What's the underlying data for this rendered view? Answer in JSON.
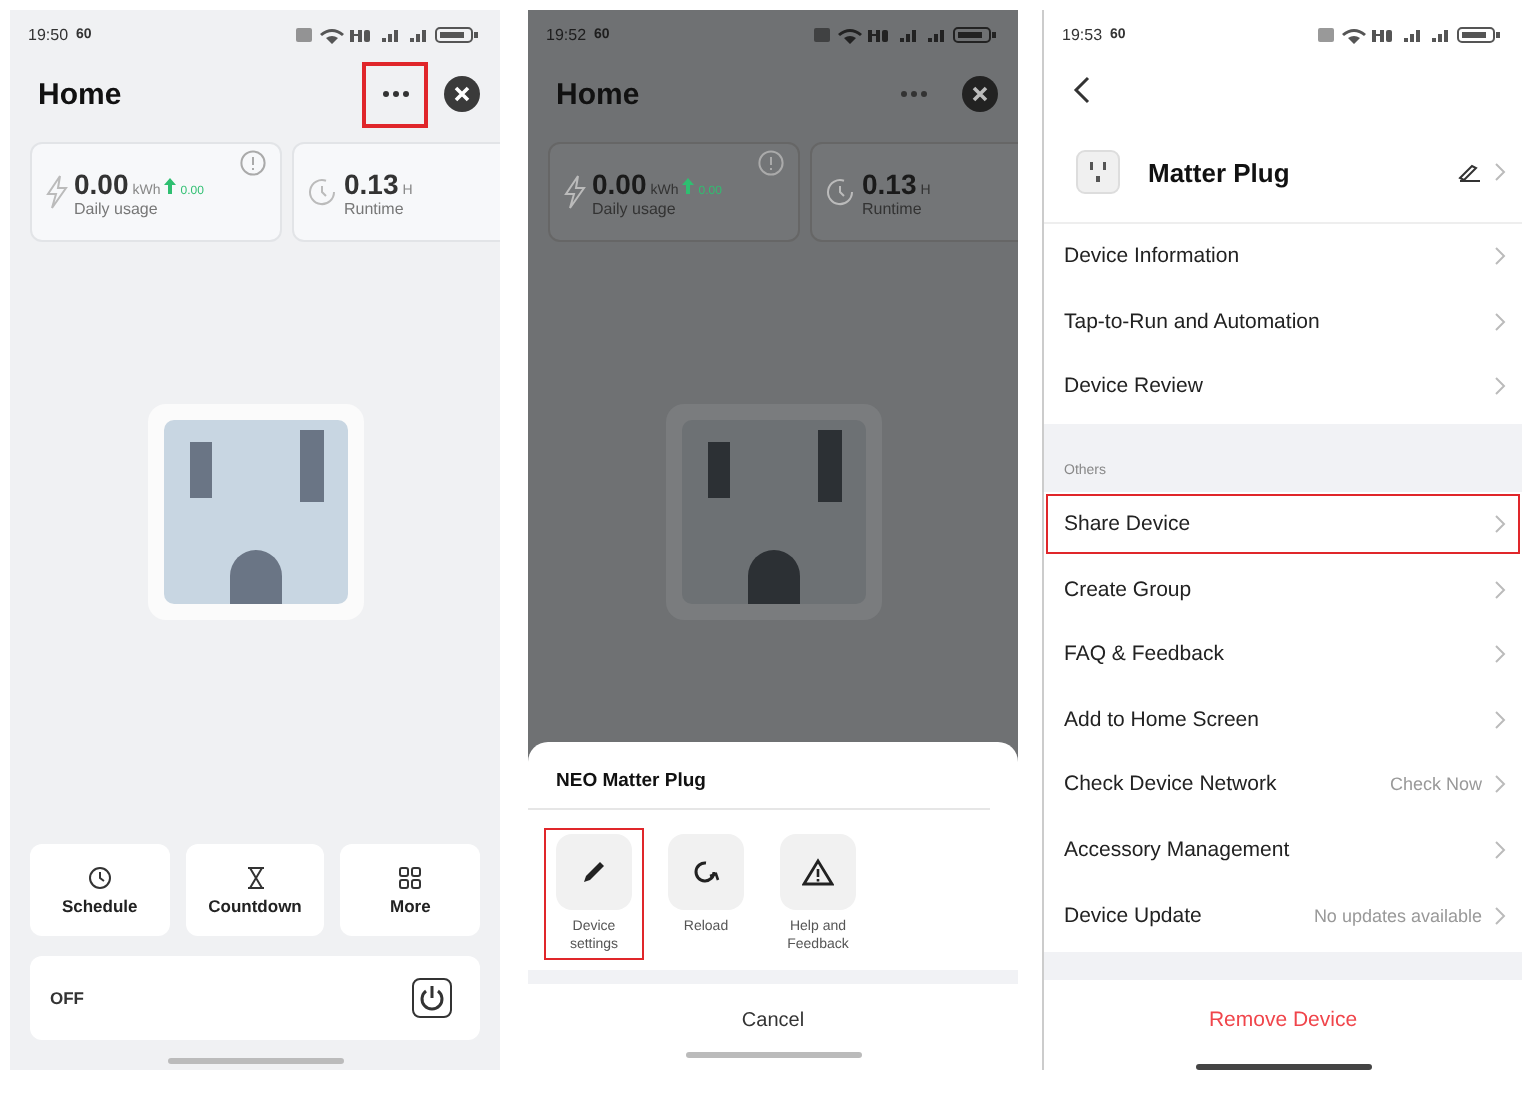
{
  "home_screen": {
    "status": {
      "time": "19:50",
      "speed": "60"
    },
    "title": "Home",
    "menu_highlighted": true,
    "stats": [
      {
        "value": "0.00",
        "unit": "kWh",
        "delta": "0.00",
        "label": "Daily usage"
      },
      {
        "value": "0.13",
        "unit": "H",
        "label": "Runtime"
      }
    ],
    "actions": [
      {
        "label": "Schedule"
      },
      {
        "label": "Countdown"
      },
      {
        "label": "More"
      }
    ],
    "power": {
      "label": "OFF",
      "on": false
    }
  },
  "menu_screen": {
    "status": {
      "time": "19:52",
      "speed": "60"
    },
    "title": "Home",
    "stats": [
      {
        "value": "0.00",
        "unit": "kWh",
        "delta": "0.00",
        "label": "Daily usage"
      },
      {
        "value": "0.13",
        "unit": "H",
        "label": "Runtime"
      }
    ],
    "sheet": {
      "title": "NEO Matter Plug",
      "actions": [
        {
          "label": "Device settings",
          "highlighted": true
        },
        {
          "label": "Reload",
          "highlighted": false
        },
        {
          "label": "Help and Feedback",
          "highlighted": false
        }
      ],
      "cancel": "Cancel"
    }
  },
  "settings_screen": {
    "status": {
      "time": "19:53",
      "speed": "60"
    },
    "device_name": "Matter Plug",
    "groups": [
      {
        "items": [
          {
            "label": "Device Information",
            "highlighted": false
          },
          {
            "label": "Tap-to-Run and Automation",
            "highlighted": false
          },
          {
            "label": "Device Review",
            "highlighted": false
          }
        ]
      },
      {
        "heading": "Others",
        "items": [
          {
            "label": "Share Device",
            "highlighted": true
          },
          {
            "label": "Create Group",
            "highlighted": false
          },
          {
            "label": "FAQ & Feedback",
            "highlighted": false
          },
          {
            "label": "Add to Home Screen",
            "highlighted": false
          },
          {
            "label": "Check Device Network",
            "value": "Check Now",
            "highlighted": false
          },
          {
            "label": "Accessory Management",
            "highlighted": false
          },
          {
            "label": "Device Update",
            "value": "No updates available",
            "highlighted": false
          }
        ]
      }
    ],
    "remove": "Remove Device"
  }
}
